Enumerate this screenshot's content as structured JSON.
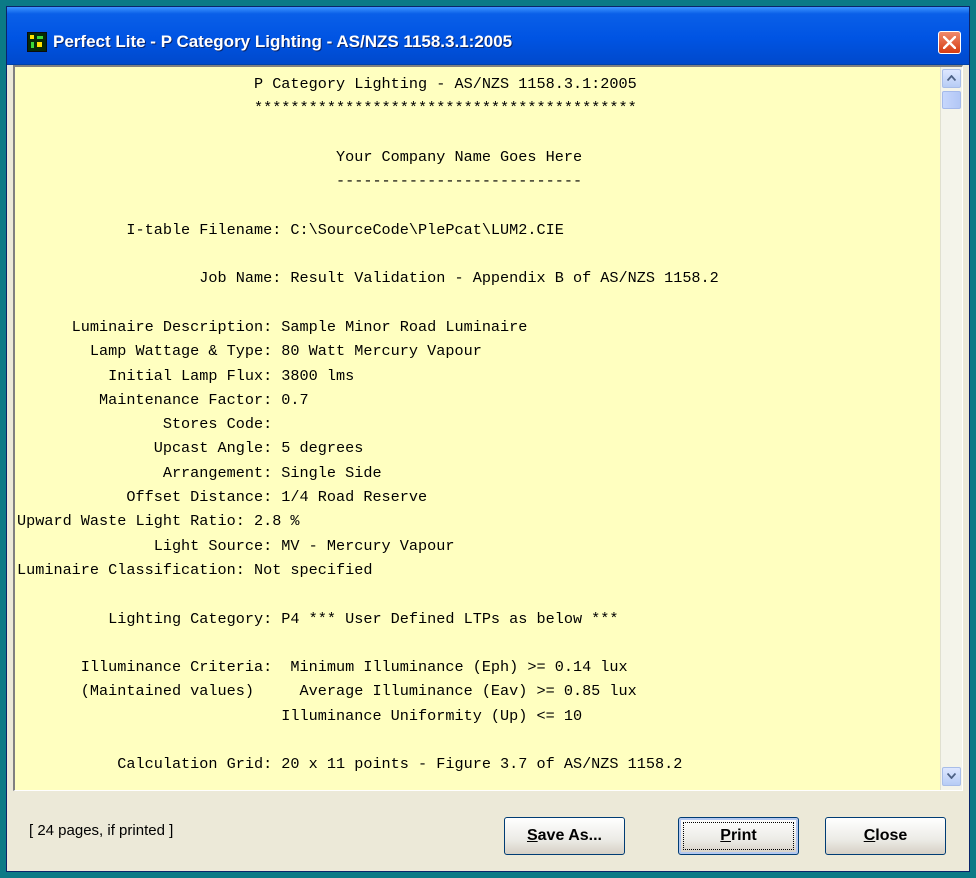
{
  "window": {
    "title": "Perfect Lite - P Category Lighting - AS/NZS 1158.3.1:2005",
    "icon": "perfect-lite-app-icon"
  },
  "report": {
    "lines": [
      "                          P Category Lighting - AS/NZS 1158.3.1:2005",
      "                          ******************************************",
      "",
      "                                   Your Company Name Goes Here",
      "                                   ---------------------------",
      "",
      "            I-table Filename: C:\\SourceCode\\PlePcat\\LUM2.CIE",
      "",
      "                    Job Name: Result Validation - Appendix B of AS/NZS 1158.2",
      "",
      "      Luminaire Description: Sample Minor Road Luminaire",
      "        Lamp Wattage & Type: 80 Watt Mercury Vapour",
      "          Initial Lamp Flux: 3800 lms",
      "         Maintenance Factor: 0.7",
      "                Stores Code:",
      "               Upcast Angle: 5 degrees",
      "                Arrangement: Single Side",
      "            Offset Distance: 1/4 Road Reserve",
      "Upward Waste Light Ratio: 2.8 %",
      "               Light Source: MV - Mercury Vapour",
      "Luminaire Classification: Not specified",
      "",
      "          Lighting Category: P4 *** User Defined LTPs as below ***",
      "",
      "       Illuminance Criteria:  Minimum Illuminance (Eph) >= 0.14 lux",
      "       (Maintained values)     Average Illuminance (Eav) >= 0.85 lux",
      "                             Illuminance Uniformity (Up) <= 10",
      "",
      "           Calculation Grid: 20 x 11 points - Figure 3.7 of AS/NZS 1158.2"
    ]
  },
  "footer": {
    "status": "[ 24 pages, if printed ]",
    "save_as_label": "Save As...",
    "save_as_mnemonic": "S",
    "save_as_rest": "ave As...",
    "print_label": "Print",
    "print_mnemonic": "P",
    "print_rest": "rint",
    "close_label": "Close",
    "close_mnemonic": "C",
    "close_rest": "lose"
  },
  "colors": {
    "report_background": "#ffffc0",
    "titlebar": "#0054e3",
    "desktop": "#0b7a86"
  }
}
